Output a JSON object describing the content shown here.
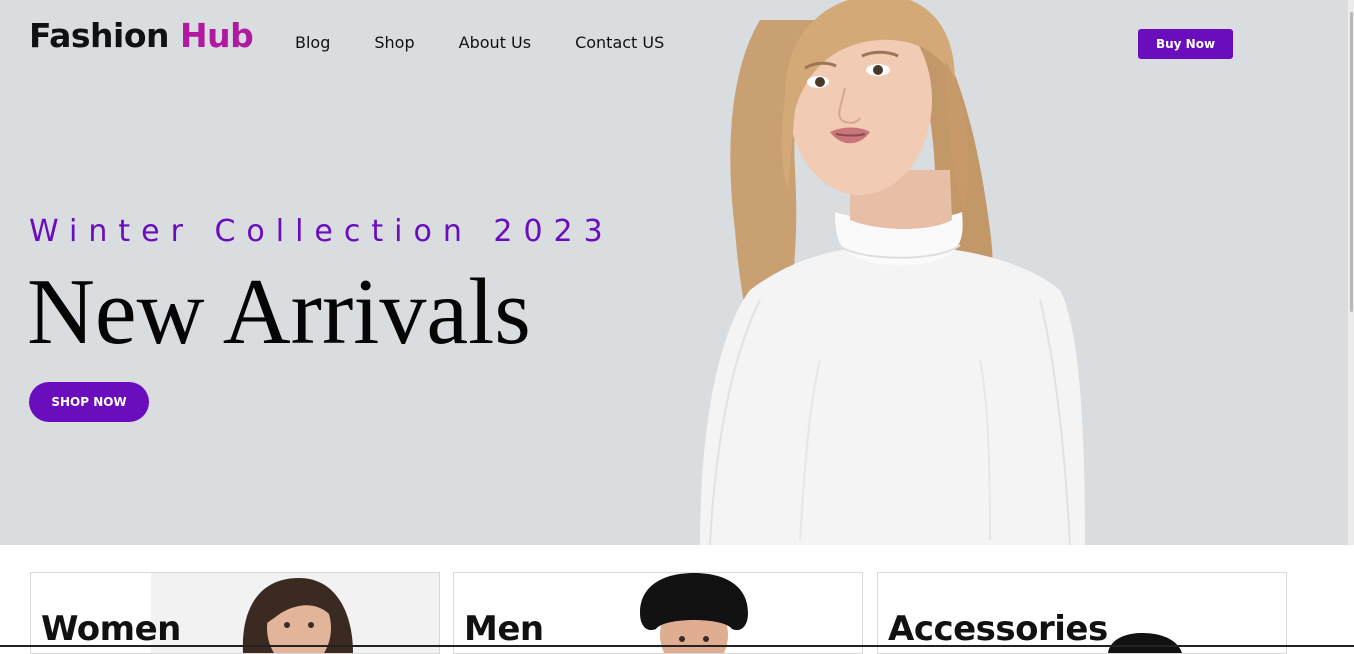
{
  "header": {
    "brand_part1": "Fashion",
    "brand_part2": "Hub",
    "nav": [
      "Blog",
      "Shop",
      "About Us",
      "Contact US"
    ],
    "buy_now_label": "Buy Now"
  },
  "hero": {
    "tagline": "Winter Collection 2023",
    "headline": "New Arrivals",
    "shop_now_label": "SHOP NOW",
    "image": "woman-white-turtleneck-photo"
  },
  "categories": [
    {
      "label": "Women",
      "image": "woman-portrait-photo"
    },
    {
      "label": "Men",
      "image": "man-bucket-hat-photo"
    },
    {
      "label": "Accessories",
      "image": "black-hat-photo"
    }
  ],
  "colors": {
    "accent": "#6a0dbd",
    "brand_accent": "#b01aa0",
    "hero_bg": "#d9dde0"
  }
}
